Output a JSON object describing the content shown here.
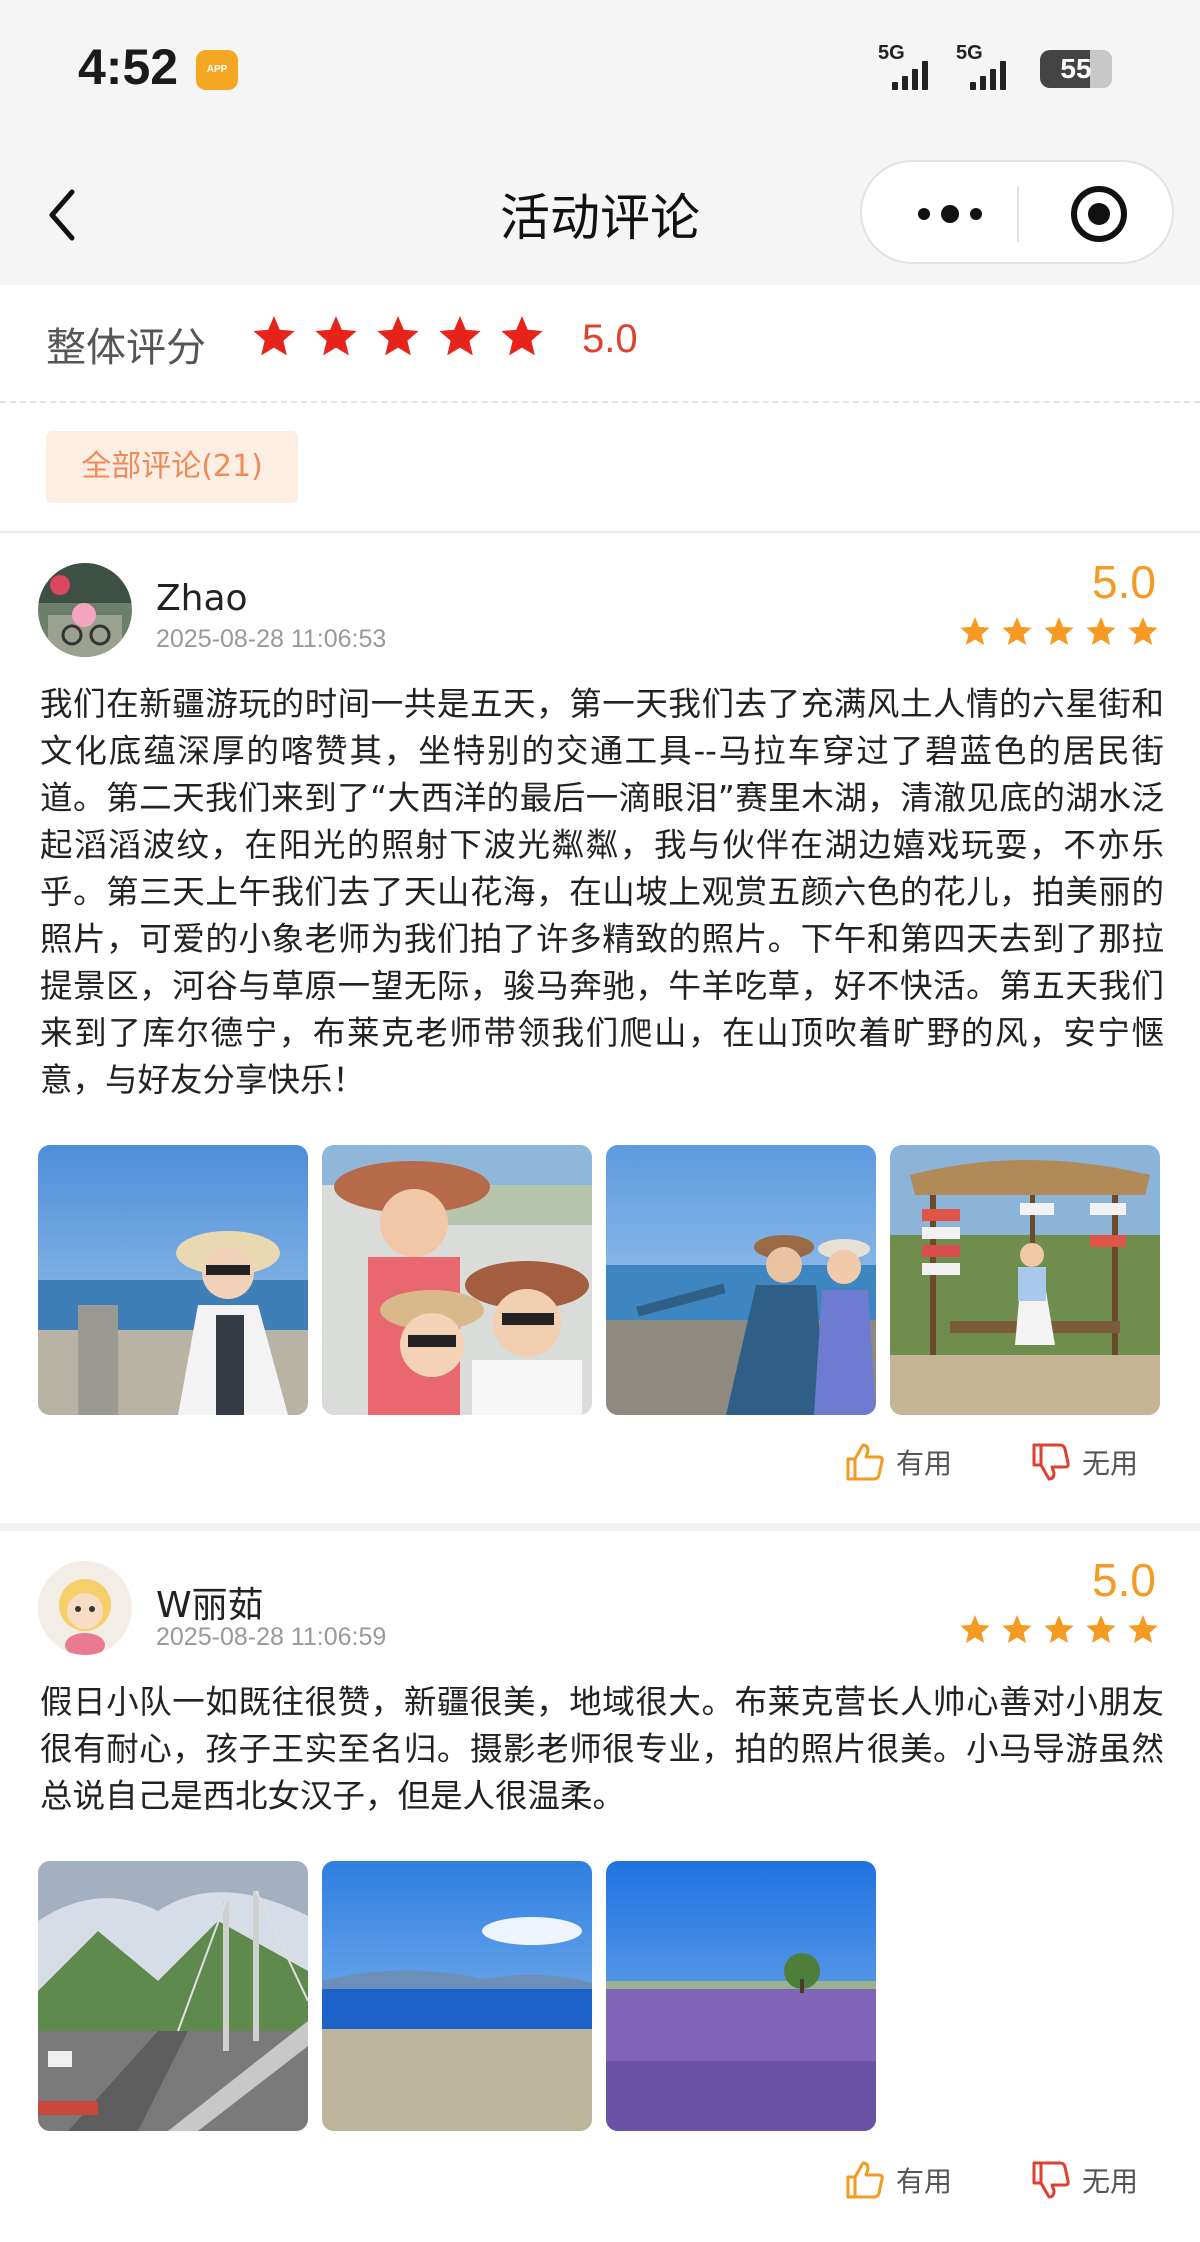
{
  "status_bar": {
    "time": "4:52",
    "app_badge": "APP",
    "signal_1": "5G",
    "signal_2": "5G",
    "battery": "55"
  },
  "nav": {
    "title": "活动评论"
  },
  "overall": {
    "label": "整体评分",
    "stars": 5,
    "score": "5.0",
    "star_color": "#e8231b"
  },
  "filter": {
    "all_label": "全部评论(21)"
  },
  "reviews": [
    {
      "name": "Zhao",
      "date": "2025-08-28 11:06:53",
      "score": "5.0",
      "stars": 5,
      "content": "我们在新疆游玩的时间一共是五天，第一天我们去了充满风土人情的六星街和文化底蕴深厚的喀赞其，坐特别的交通工具--马拉车穿过了碧蓝色的居民街道。第二天我们来到了“大西洋的最后一滴眼泪”赛里木湖，清澈见底的湖水泛起滔滔波纹，在阳光的照射下波光粼粼，我与伙伴在湖边嬉戏玩耍，不亦乐乎。第三天上午我们去了天山花海，在山坡上观赏五颜六色的花儿，拍美丽的照片，可爱的小象老师为我们拍了许多精致的照片。下午和第四天去到了那拉提景区，河谷与草原一望无际，骏马奔驰，牛羊吃草，好不快活。第五天我们来到了库尔德宁，布莱克老师带领我们爬山，在山顶吹着旷野的风，安宁惬意，与好友分享快乐！",
      "photo_count": 4,
      "useful_label": "有用",
      "useless_label": "无用"
    },
    {
      "name": "W丽茹",
      "date": "2025-08-28 11:06:59",
      "score": "5.0",
      "stars": 5,
      "content": "假日小队一如既往很赞，新疆很美，地域很大。布莱克营长人帅心善对小朋友很有耐心，孩子王实至名归。摄影老师很专业，拍的照片很美。小马导游虽然总说自己是西北女汉子，但是人很温柔。",
      "photo_count": 3,
      "useful_label": "有用",
      "useless_label": "无用"
    }
  ],
  "colors": {
    "accent_orange": "#f59a23",
    "score_red": "#e0402d",
    "filter_bg": "#fdeee4",
    "filter_text": "#ee8a55",
    "thumb_up": "#f59a23",
    "thumb_down": "#e0402d"
  },
  "icons": {
    "back": "chevron-left-icon",
    "more": "more-dots-icon",
    "close_target": "target-circle-icon",
    "useful": "thumb-up-icon",
    "useless": "thumb-down-icon"
  }
}
